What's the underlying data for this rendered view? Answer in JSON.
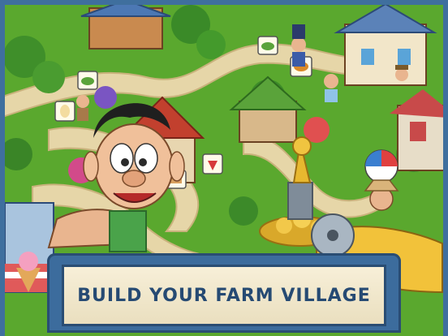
{
  "banner": {
    "title": "BUILD YOUR FARM VILLAGE"
  },
  "icons": {
    "task_bubbles": [
      "bowl-icon",
      "bowl-icon",
      "pie-icon",
      "egg-icon",
      "strawberry-icon",
      "cake-icon"
    ]
  },
  "colors": {
    "grass": "#5aa82e",
    "path": "#e3d2a4",
    "frame_blue": "#3c6c9d",
    "banner_text": "#264a73",
    "paper": "#f2e8cc"
  }
}
